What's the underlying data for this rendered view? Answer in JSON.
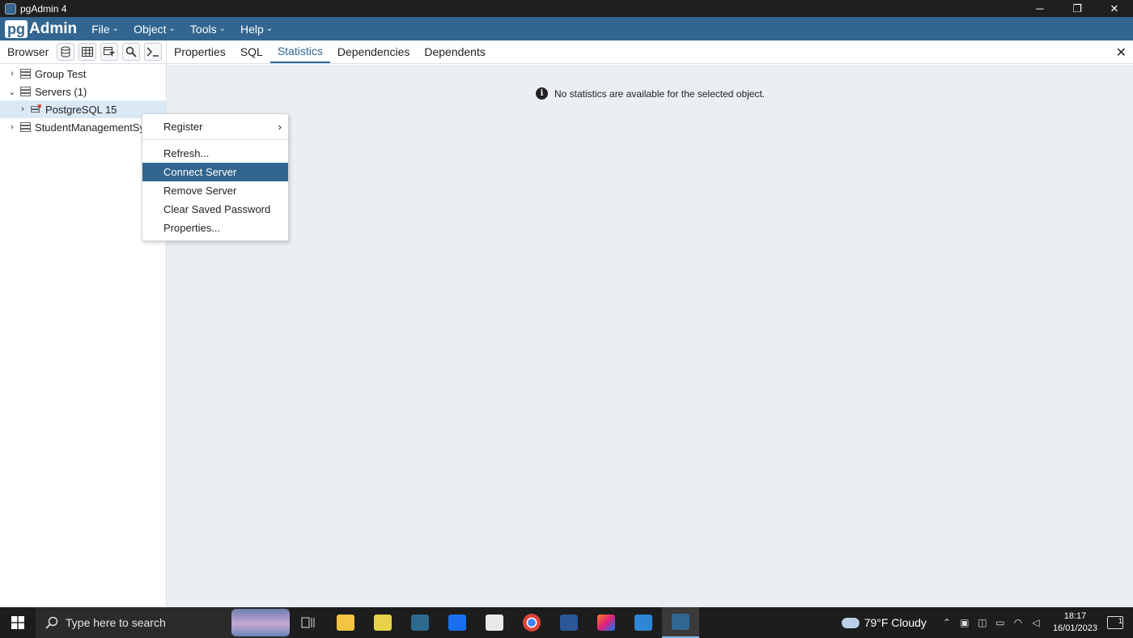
{
  "window": {
    "title": "pgAdmin 4",
    "controls": {
      "minimize": "─",
      "maximize": "❐",
      "close": "✕"
    }
  },
  "menubar": {
    "logo_pg": "pg",
    "logo_admin": "Admin",
    "items": [
      {
        "label": "File"
      },
      {
        "label": "Object"
      },
      {
        "label": "Tools"
      },
      {
        "label": "Help"
      }
    ]
  },
  "browser": {
    "label": "Browser",
    "tree": [
      {
        "label": "Group Test",
        "caret": "›"
      },
      {
        "label": "Servers (1)",
        "caret": "⌄"
      },
      {
        "label": "PostgreSQL 15",
        "caret": "›"
      },
      {
        "label": "StudentManagementSys",
        "caret": "›"
      }
    ]
  },
  "tabs": {
    "items": [
      {
        "label": "Properties"
      },
      {
        "label": "SQL"
      },
      {
        "label": "Statistics"
      },
      {
        "label": "Dependencies"
      },
      {
        "label": "Dependents"
      }
    ],
    "active": "Statistics",
    "close": "✕"
  },
  "main": {
    "info_message": "No statistics are available for the selected object.",
    "info_icon": "i"
  },
  "context_menu": {
    "items": [
      {
        "label": "Register",
        "submenu": "›"
      },
      {
        "label": "Refresh..."
      },
      {
        "label": "Connect Server"
      },
      {
        "label": "Remove Server"
      },
      {
        "label": "Clear Saved Password"
      },
      {
        "label": "Properties..."
      }
    ],
    "highlighted": "Connect Server"
  },
  "taskbar": {
    "search_placeholder": "Type here to search",
    "weather": {
      "temp": "79°F",
      "condition": "Cloudy"
    },
    "clock": {
      "time": "18:17",
      "date": "16/01/2023"
    },
    "notification_count": "1"
  },
  "colors": {
    "accent": "#326690",
    "main_bg": "#ebeef3",
    "taskbar": "#1d1d1d"
  }
}
